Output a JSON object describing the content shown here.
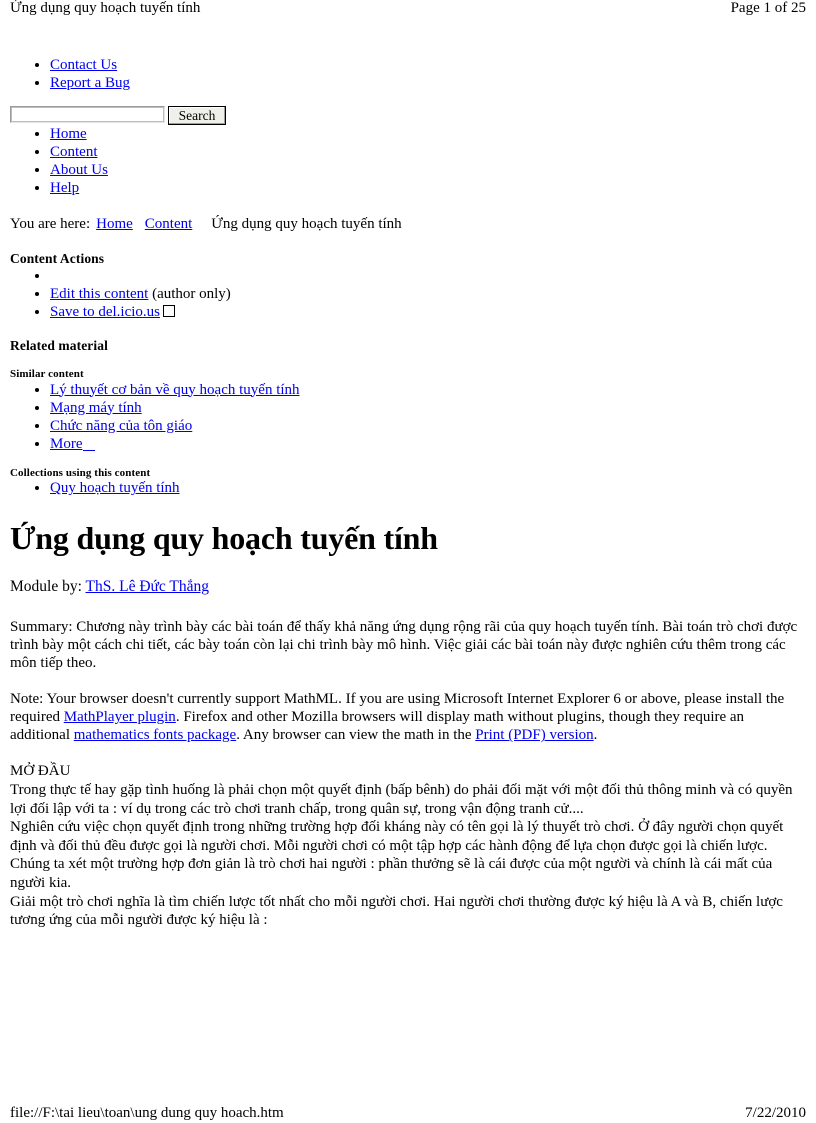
{
  "print": {
    "header_title": "Ứng dụng quy hoạch tuyến tính",
    "header_page": "Page 1 of 25",
    "footer_path": "file://F:\\tai lieu\\toan\\ung dung quy hoach.htm",
    "footer_date": "7/22/2010"
  },
  "portal_links": [
    {
      "label": "Contact Us"
    },
    {
      "label": "Report a Bug"
    }
  ],
  "search": {
    "value": "",
    "placeholder": "",
    "button_label": "Search"
  },
  "site_nav": [
    {
      "label": "Home"
    },
    {
      "label": "Content"
    },
    {
      "label": "About Us"
    },
    {
      "label": "Help"
    }
  ],
  "breadcrumb": {
    "prefix": "You are here:",
    "items": [
      {
        "label": "Home",
        "link": true
      },
      {
        "label": "Content",
        "link": true
      }
    ],
    "current": "Ứng dụng quy hoạch tuyến tính"
  },
  "content_actions": {
    "heading": "Content Actions",
    "items": [
      {
        "label": "",
        "suffix": "",
        "icon": ""
      },
      {
        "label": "Edit this content",
        "suffix": " (author only)",
        "icon": ""
      },
      {
        "label": "Save to del.icio.us",
        "suffix": "",
        "icon": "broken-image-placeholder"
      }
    ]
  },
  "related": {
    "heading": "Related material",
    "similar_heading": "Similar content",
    "similar_items": [
      {
        "label": "Lý thuyết cơ bản về quy hoạch tuyến tính"
      },
      {
        "label": "Mạng máy tính"
      },
      {
        "label": "Chức năng của tôn giáo"
      },
      {
        "label": "More"
      }
    ],
    "collections_heading": "Collections using this content",
    "collections_items": [
      {
        "label": "Quy hoạch tuyến tính"
      }
    ]
  },
  "module": {
    "title": "Ứng dụng quy hoạch tuyến tính",
    "by_label": "Module by:",
    "author": "ThS. Lê Đức Thắng",
    "summary_label": "Summary:",
    "summary_text": " Chương này trình bày các bài toán để thấy khả năng ứng dụng rộng rãi của quy hoạch tuyến tính. Bài toán trò chơi được trình bày một cách chi tiết, các bày toán còn lại chi trình bày mô hình. Việc giải các bài toán này được nghiên cứu thêm trong các môn tiếp theo."
  },
  "note": {
    "part1": "Note: Your browser doesn't currently support MathML. If you are using Microsoft Internet Explorer 6 or above, please install the required ",
    "link1": "MathPlayer plugin",
    "part2": ". Firefox and other Mozilla browsers will display math without plugins, though they require an additional ",
    "link2": "mathematics fonts package",
    "part3": ". Any browser can view the math in the ",
    "link3": "Print (PDF) version",
    "part4": "."
  },
  "body": {
    "section_heading": "MỞ ĐẦU",
    "paragraphs": [
      "Trong thực tế hay gặp tình huống là phải chọn một quyết định (bấp bênh) do phải đối mặt với một đối thủ thông minh và có quyền lợi đối lập với ta : ví dụ trong các trò chơi tranh chấp, trong quân sự, trong vận động tranh cử....",
      "Nghiên cứu việc chọn quyết định trong những trường hợp đối kháng này có tên gọi là lý thuyết trò chơi. Ở đây người chọn quyết định và đối thủ đều được gọi là người chơi. Mỗi người chơi có một tập hợp các hành động để lựa chọn được gọi là chiến lược.",
      "Chúng ta xét một trường hợp đơn giản là trò chơi hai người : phần thưởng sẽ là cái được của một người và chính là cái mất của người kia.",
      "Giải một trò chơi nghĩa là tìm chiến lược tốt nhất cho mỗi người chơi. Hai người chơi thường được ký hiệu là A và B, chiến lược tương ứng của mỗi người được ký hiệu là :"
    ]
  },
  "colors": {
    "link": "#0000EE",
    "text": "#000000",
    "background": "#FFFFFF",
    "button_face": "#F0F0EA"
  }
}
